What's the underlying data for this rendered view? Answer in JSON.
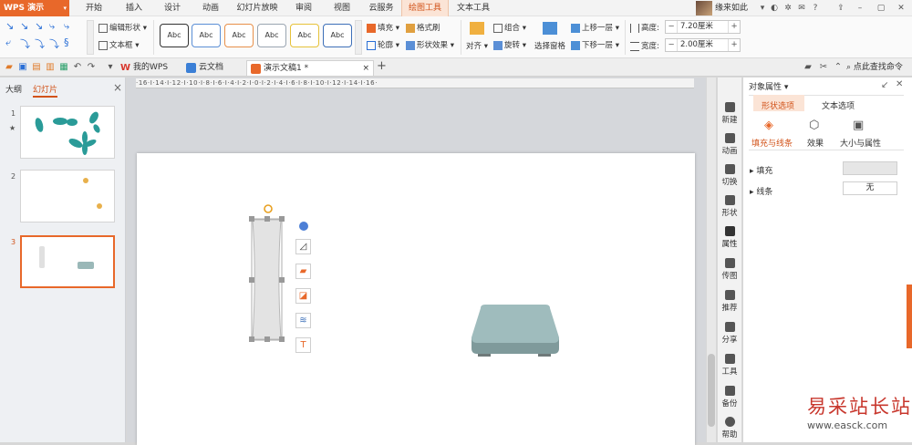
{
  "app": {
    "name": "WPS 演示",
    "dropdown": "▾"
  },
  "menu": {
    "tabs": [
      {
        "label": "开始"
      },
      {
        "label": "插入"
      },
      {
        "label": "设计"
      },
      {
        "label": "动画"
      },
      {
        "label": "幻灯片放映"
      },
      {
        "label": "审阅"
      },
      {
        "label": "视图"
      },
      {
        "label": "云服务"
      },
      {
        "label": "绘图工具"
      },
      {
        "label": "文本工具"
      }
    ],
    "active_tab": "绘图工具"
  },
  "user": {
    "name": "缘来如此"
  },
  "ribbon": {
    "edit_shape": "编辑形状",
    "text_box": "文本框",
    "style_label": "Abc",
    "fill": "填充",
    "format_painter": "格式刷",
    "outline": "轮廓",
    "shape_effects": "形状效果",
    "align": "对齐",
    "group": "组合",
    "rotate": "旋转",
    "selection_pane": "选择窗格",
    "bring_forward": "上移一层",
    "send_backward": "下移一层",
    "height_label": "高度:",
    "height_value": "7.20厘米",
    "width_label": "宽度:",
    "width_value": "2.00厘米",
    "minus": "−",
    "plus": "+"
  },
  "tabbar": {
    "docs": [
      {
        "label": "我的WPS"
      },
      {
        "label": "云文档"
      },
      {
        "label": "演示文稿1 *"
      }
    ],
    "close": "×",
    "new_tab": "+",
    "search": "点此查找命令"
  },
  "left_panel": {
    "tabs": [
      {
        "label": "大纲"
      },
      {
        "label": "幻灯片"
      }
    ],
    "close": "×",
    "slides": [
      {
        "num": "1",
        "mark": "★"
      },
      {
        "num": "2"
      },
      {
        "num": "3"
      }
    ]
  },
  "ruler": {
    "text": "·16·I·14·I·12·I·10·I·8·I·6·I·4·I·2·I·0·I·2·I·4·I·6·I·8·I·10·I·12·I·14·I·16·"
  },
  "rail": {
    "items": [
      {
        "label": "新建"
      },
      {
        "label": "动画"
      },
      {
        "label": "切换"
      },
      {
        "label": "形状"
      },
      {
        "label": "属性"
      },
      {
        "label": "传图"
      },
      {
        "label": "推荐"
      },
      {
        "label": "分享"
      },
      {
        "label": "工具"
      },
      {
        "label": "备份"
      },
      {
        "label": "帮助"
      }
    ]
  },
  "props": {
    "title": "对象属性",
    "title_dd": "▾",
    "tabs": [
      {
        "label": "形状选项"
      },
      {
        "label": "文本选项"
      }
    ],
    "sub_tabs": [
      {
        "label": "填充与线条"
      },
      {
        "label": "效果"
      },
      {
        "label": "大小与属性"
      }
    ],
    "fill_label": "填充",
    "line_label": "线条",
    "line_value": "无"
  },
  "watermark": {
    "cn": "易采站长站",
    "url": "www.easck.com"
  },
  "colors": {
    "accent": "#e8682a",
    "teal": "#2a9b98",
    "dot": "#e8b04b"
  }
}
